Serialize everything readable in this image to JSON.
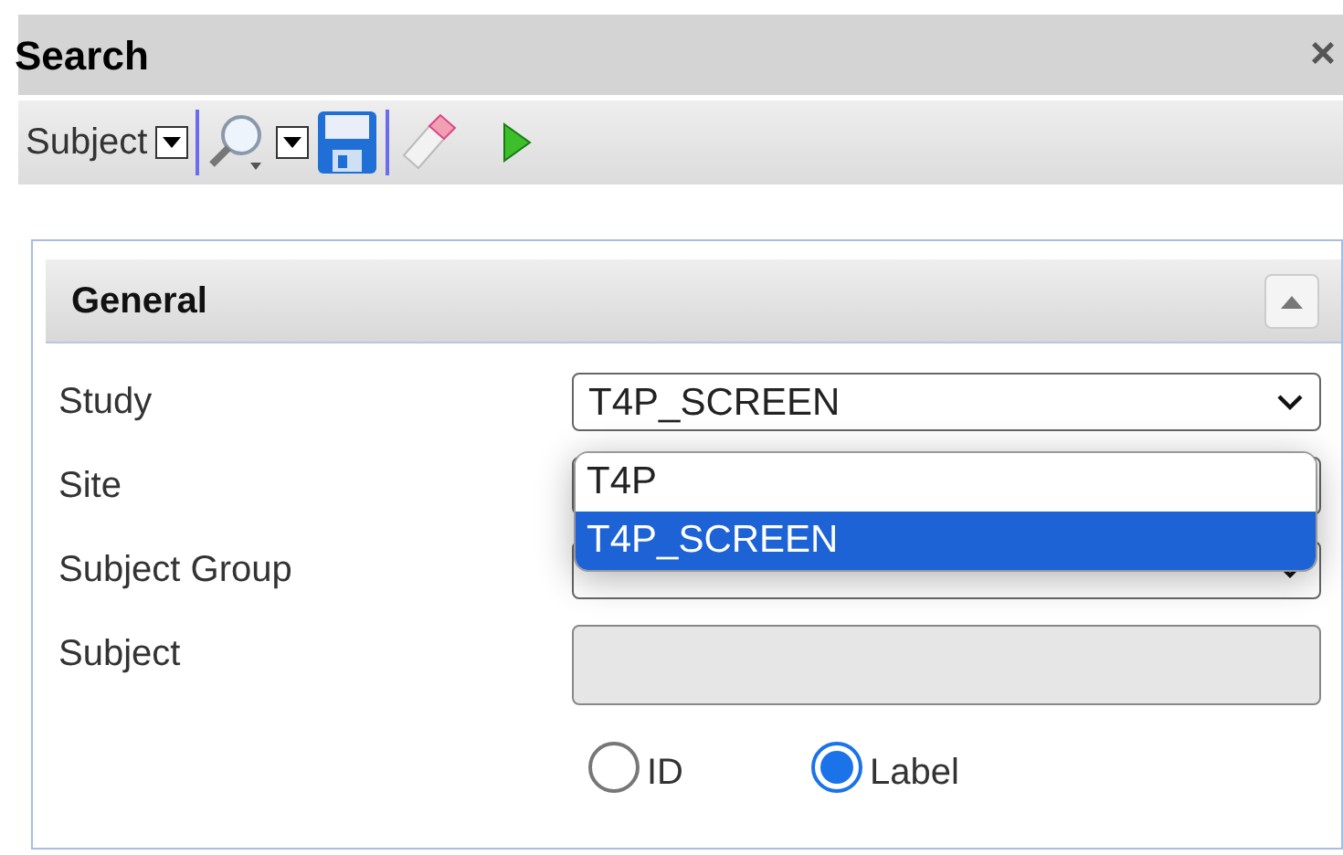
{
  "window": {
    "title": "Search",
    "close": "×"
  },
  "toolbar": {
    "selector": "Subject"
  },
  "panel": {
    "title": "General",
    "fields": [
      {
        "label": "Study",
        "kind": "select",
        "value": "T4P_SCREEN",
        "caret": true
      },
      {
        "label": "Site",
        "kind": "select"
      },
      {
        "label": "Subject Group",
        "kind": "select",
        "caret": true
      },
      {
        "label": "Subject",
        "kind": "text"
      }
    ],
    "dropdown": {
      "options": [
        {
          "label": "T4P",
          "selected": false
        },
        {
          "label": "T4P_SCREEN",
          "selected": true
        }
      ]
    },
    "radios": [
      {
        "label": "ID",
        "selected": false
      },
      {
        "label": "Label",
        "selected": true
      }
    ]
  }
}
